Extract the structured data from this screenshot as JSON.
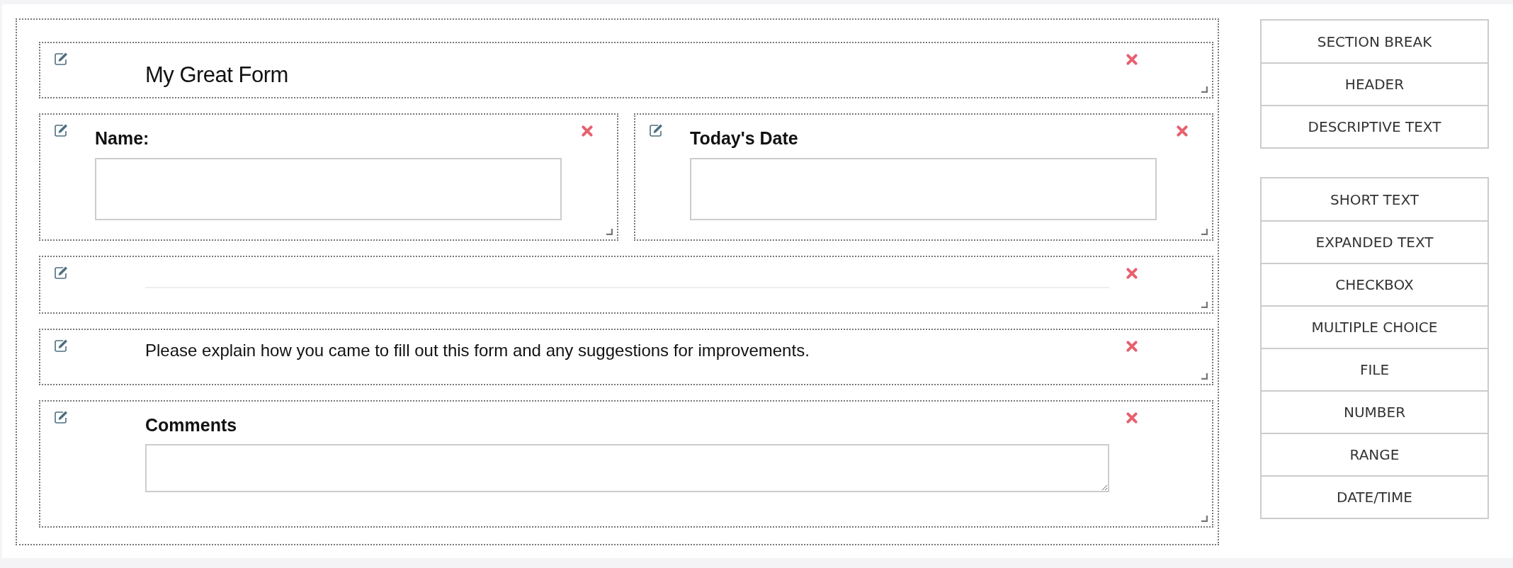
{
  "form": {
    "rows": [
      {
        "blocks": [
          {
            "kind": "header",
            "text": "My Great Form"
          }
        ]
      },
      {
        "blocks": [
          {
            "kind": "short_text",
            "label": "Name:"
          },
          {
            "kind": "short_text",
            "label": "Today's Date"
          }
        ]
      },
      {
        "blocks": [
          {
            "kind": "section_break"
          }
        ]
      },
      {
        "blocks": [
          {
            "kind": "descriptive_text",
            "text": "Please explain how you came to fill out this form and any suggestions for improvements."
          }
        ]
      },
      {
        "blocks": [
          {
            "kind": "expanded_text",
            "label": "Comments"
          }
        ]
      }
    ]
  },
  "palette": {
    "groups": [
      {
        "items": [
          "SECTION BREAK",
          "HEADER",
          "DESCRIPTIVE TEXT"
        ]
      },
      {
        "items": [
          "SHORT TEXT",
          "EXPANDED TEXT",
          "CHECKBOX",
          "MULTIPLE CHOICE",
          "FILE",
          "NUMBER",
          "RANGE",
          "DATE/TIME"
        ]
      }
    ]
  }
}
